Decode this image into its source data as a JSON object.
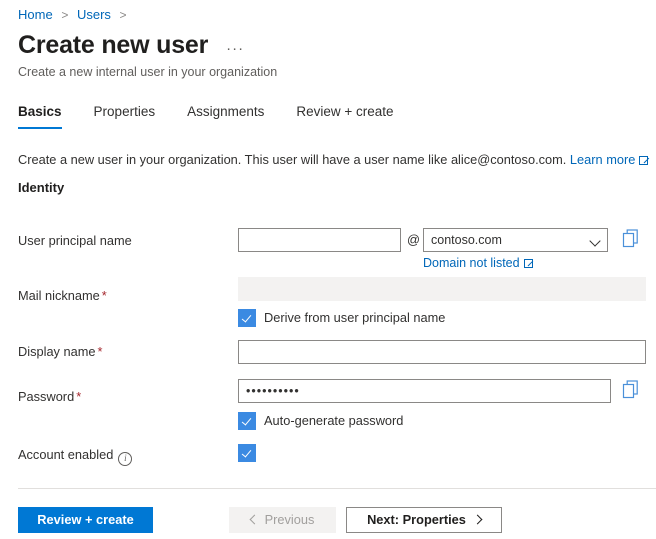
{
  "breadcrumb": {
    "items": [
      {
        "label": "Home"
      },
      {
        "label": "Users"
      }
    ],
    "separator": ">"
  },
  "header": {
    "title": "Create new user",
    "more_menu": "···",
    "subtitle": "Create a new internal user in your organization"
  },
  "tabs": [
    {
      "label": "Basics",
      "active": true
    },
    {
      "label": "Properties",
      "active": false
    },
    {
      "label": "Assignments",
      "active": false
    },
    {
      "label": "Review + create",
      "active": false
    }
  ],
  "description": {
    "text": "Create a new user in your organization. This user will have a user name like alice@contoso.com.",
    "link_label": "Learn more"
  },
  "section": {
    "heading": "Identity"
  },
  "form": {
    "upn": {
      "label": "User principal name",
      "value": "",
      "at": "@",
      "domain_value": "contoso.com",
      "domain_link": "Domain not listed",
      "copy_icon": "copy-icon"
    },
    "mail_nickname": {
      "label": "Mail nickname",
      "required": "*",
      "value": "",
      "checkbox_label": "Derive from user principal name",
      "checked": true
    },
    "display_name": {
      "label": "Display name",
      "required": "*",
      "value": ""
    },
    "password": {
      "label": "Password",
      "required": "*",
      "value": "••••••••••",
      "copy_icon": "copy-icon",
      "checkbox_label": "Auto-generate password",
      "checked": true
    },
    "account_enabled": {
      "label": "Account enabled",
      "info_icon": "info-icon",
      "checked": true
    }
  },
  "footer": {
    "primary_label": "Review + create",
    "previous_label": "Previous",
    "next_label": "Next: Properties"
  },
  "colors": {
    "accent": "#0078d4",
    "link": "#0067b8",
    "checkbox": "#3b8ae2",
    "required": "#a4262c",
    "disabled_bg": "#f3f2f1"
  }
}
